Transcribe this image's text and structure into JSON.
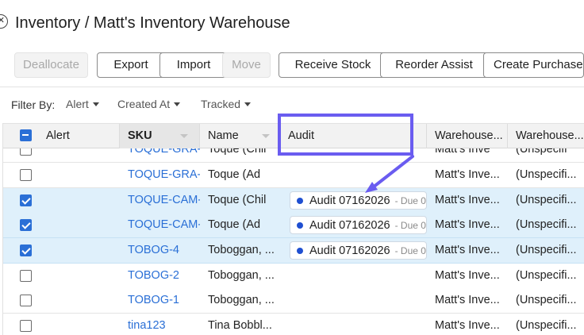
{
  "page": {
    "title": "Inventory / Matt's Inventory Warehouse"
  },
  "toolbar": [
    {
      "label": "Deallocate",
      "disabled": true
    },
    {
      "label": "Export",
      "disabled": false
    },
    {
      "label": "Import",
      "disabled": false
    },
    {
      "label": "Move",
      "disabled": true
    },
    {
      "label": "Receive Stock",
      "disabled": false
    },
    {
      "label": "Reorder Assist",
      "disabled": false
    },
    {
      "label": "Create Purchase O",
      "disabled": false
    }
  ],
  "filters": {
    "label": "Filter By:",
    "items": [
      "Alert",
      "Created At",
      "Tracked"
    ]
  },
  "table": {
    "columns": [
      "Alert",
      "SKU",
      "Name",
      "Audit",
      "Warehouse...",
      "Warehouse..."
    ],
    "sorted_column": "SKU",
    "rows": [
      {
        "sku": "TOQUE-GRA-",
        "name": "Toque (Chil",
        "audit": "",
        "due": "",
        "warehouse": "Matt's Inve",
        "location": "(Unspecifi",
        "selected": false
      },
      {
        "sku": "TOQUE-GRA-",
        "name": "Toque (Ad",
        "audit": "",
        "due": "",
        "warehouse": "Matt's Inve...",
        "location": "(Unspecifi...",
        "selected": false
      },
      {
        "sku": "TOQUE-CAM-",
        "name": "Toque (Chil",
        "audit": "Audit 07162026",
        "due": "- Due 0",
        "warehouse": "Matt's Inve...",
        "location": "(Unspecifi...",
        "selected": true
      },
      {
        "sku": "TOQUE-CAM-",
        "name": "Toque (Ad",
        "audit": "Audit 07162026",
        "due": "- Due 0",
        "warehouse": "Matt's Inve...",
        "location": "(Unspecifi...",
        "selected": true
      },
      {
        "sku": "TOBOG-4",
        "name": "Toboggan, ...",
        "audit": "Audit 07162026",
        "due": "- Due 0",
        "warehouse": "Matt's Inve...",
        "location": "(Unspecifi...",
        "selected": true
      },
      {
        "sku": "TOBOG-2",
        "name": "Toboggan, ...",
        "audit": "",
        "due": "",
        "warehouse": "Matt's Inve...",
        "location": "(Unspecifi...",
        "selected": false
      },
      {
        "sku": "TOBOG-1",
        "name": "Toboggan, ...",
        "audit": "",
        "due": "",
        "warehouse": "Matt's Inve...",
        "location": "(Unspecifi...",
        "selected": false
      },
      {
        "sku": "tina123",
        "name": "Tina Bobbl...",
        "audit": "",
        "due": "",
        "warehouse": "Matt's Inve...",
        "location": "(Unspecifi...",
        "selected": false
      }
    ]
  },
  "colors": {
    "accent": "#2a6fd6",
    "selected_row": "#dff0fb",
    "annotation": "#6a5cf0",
    "chip_dot": "#1f4fd1"
  }
}
